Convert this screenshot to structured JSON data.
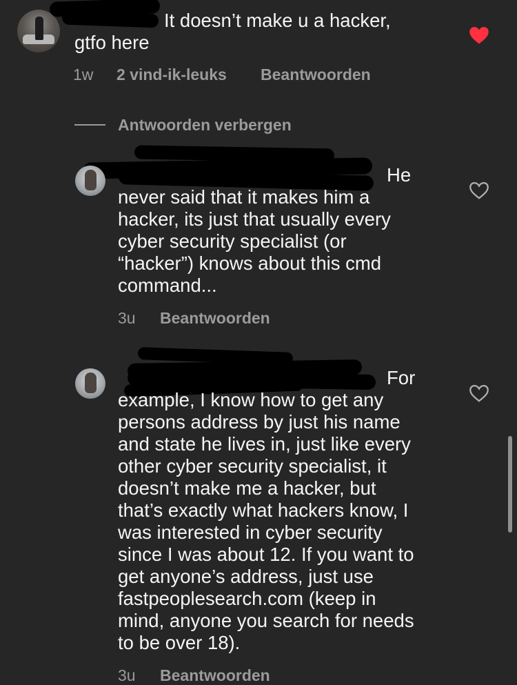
{
  "comment": {
    "text": "It doesn’t make u a hacker,\ngtfo here",
    "time": "1w",
    "likes": "2 vind-ik-leuks",
    "reply_label": "Beantwoorden",
    "liked": true
  },
  "toggle_replies_label": "Antwoorden verbergen",
  "replies": [
    {
      "text_line1": "He",
      "text_rest": "never said that it makes him a\nhacker, its just that usually every\ncyber security specialist (or\n“hacker”) knows about this cmd\ncommand...",
      "time": "3u",
      "reply_label": "Beantwoorden"
    },
    {
      "text_line1": "For",
      "text_rest": "example, I know how to get any\npersons address by just his name\nand state he lives in, just like every\nother cyber security specialist, it\ndoesn’t make me a hacker, but\nthat’s exactly what hackers know, I\nwas interested in cyber security\nsince I was about 12. If you want to\nget anyone’s address, just use\nfastpeoplesearch.com (keep in\nmind, anyone you search for needs\nto be over 18).",
      "time": "3u",
      "reply_label": "Beantwoorden"
    }
  ],
  "colors": {
    "background": "#262626",
    "liked_heart": "#ff3040",
    "text": "#f5f5f5",
    "meta": "#9b9b9b"
  },
  "icons": {
    "liked": "heart-filled-icon",
    "unliked": "heart-outline-icon"
  }
}
